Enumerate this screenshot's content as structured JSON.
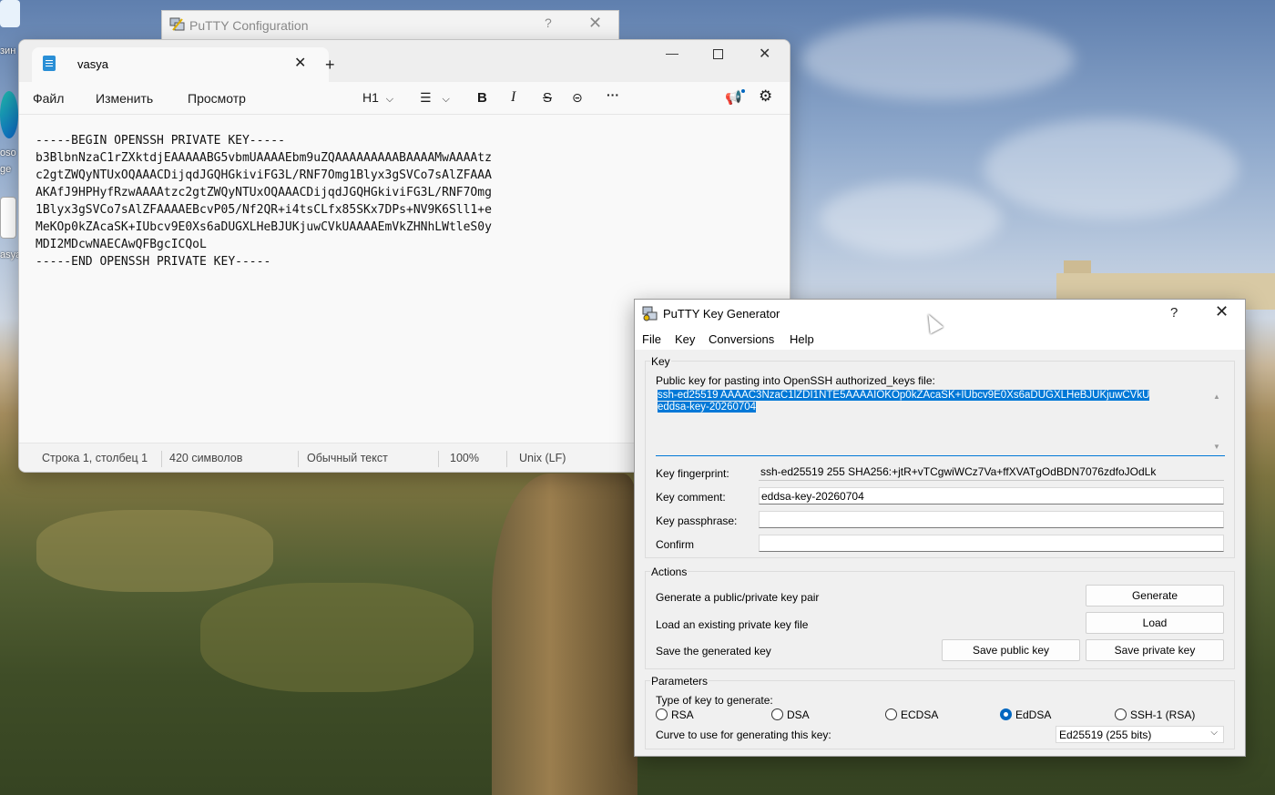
{
  "desktop": {
    "icons": [
      {
        "label": "зин",
        "icon": "recycle-bin-icon"
      },
      {
        "label": "oso",
        "icon": "edge-icon"
      },
      {
        "label": "ge",
        "icon": "edge-icon"
      },
      {
        "label": "asya",
        "icon": "text-file-icon"
      }
    ]
  },
  "putty_config": {
    "title": "PuTTY Configuration",
    "help": "?",
    "close": "✕"
  },
  "notepad": {
    "tab_title": "vasya",
    "tab_close": "✕",
    "new_tab": "+",
    "window_controls": {
      "minimize": "—",
      "close": "✕"
    },
    "menus": [
      "Файл",
      "Изменить",
      "Просмотр"
    ],
    "toolbar": {
      "heading": "H1",
      "heading_chevron": "⌵",
      "list_icon": "☰",
      "list_chevron": "⌵",
      "bold": "B",
      "italic": "I",
      "strike": "S",
      "link": "⊝",
      "more": "···",
      "announce": "📢",
      "settings": "⚙"
    },
    "content_lines": [
      "-----BEGIN OPENSSH PRIVATE KEY-----",
      "b3BlbnNzaC1rZXktdjEAAAAABG5vbmUAAAAEbm9uZQAAAAAAAAABAAAAMwAAAAtz",
      "c2gtZWQyNTUxOQAAACDijqdJGQHGkiviFG3L/RNF7Omg1Blyx3gSVCo7sAlZFAAA",
      "AKAfJ9HPHyfRzwAAAAtzc2gtZWQyNTUxOQAAACDijqdJGQHGkiviFG3L/RNF7Omg",
      "1Blyx3gSVCo7sAlZFAAAAEBcvP05/Nf2QR+i4tsCLfx85SKx7DPs+NV9K6Sll1+e",
      "MeKOp0kZAcaSK+IUbcv9E0Xs6aDUGXLHeBJUKjuwCVkUAAAAEmVkZHNhLWtleS0y",
      "MDI2MDcwNAECAwQFBgcICQoL",
      "-----END OPENSSH PRIVATE KEY-----"
    ],
    "status": {
      "position": "Строка 1, столбец 1",
      "chars": "420 символов",
      "encoding": "Обычный текст",
      "zoom": "100%",
      "line_endings": "Unix (LF)"
    }
  },
  "keygen": {
    "title": "PuTTY Key Generator",
    "help": "?",
    "close": "✕",
    "menus": [
      "File",
      "Key",
      "Conversions",
      "Help"
    ],
    "key_group": "Key",
    "pubkey_label": "Public key for pasting into OpenSSH authorized_keys file:",
    "pubkey_line1": "ssh-ed25519 AAAAC3NzaC1lZDI1NTE5AAAAIOKOp0kZAcaSK+IUbcv9E0Xs6aDUGXLHeBJUKjuwCVkU",
    "pubkey_line2": "eddsa-key-20260704",
    "fingerprint_label": "Key fingerprint:",
    "fingerprint_value": "ssh-ed25519 255 SHA256:+jtR+vTCgwiWCz7Va+ffXVATgOdBDN7076zdfoJOdLk",
    "comment_label": "Key comment:",
    "comment_value": "eddsa-key-20260704",
    "passphrase_label": "Key passphrase:",
    "passphrase_value": "",
    "confirm_label": "Confirm",
    "confirm_value": "",
    "actions_group": "Actions",
    "generate_label": "Generate a public/private key pair",
    "generate_button": "Generate",
    "load_label": "Load an existing private key file",
    "load_button": "Load",
    "save_label": "Save the generated key",
    "save_public_button": "Save public key",
    "save_private_button": "Save private key",
    "params_group": "Parameters",
    "type_label": "Type of key to generate:",
    "key_types": [
      "RSA",
      "DSA",
      "ECDSA",
      "EdDSA",
      "SSH-1 (RSA)"
    ],
    "selected_type": "EdDSA",
    "curve_label": "Curve to use for generating this key:",
    "curve_value": "Ed25519 (255 bits)",
    "curve_chevron": "⌵"
  }
}
